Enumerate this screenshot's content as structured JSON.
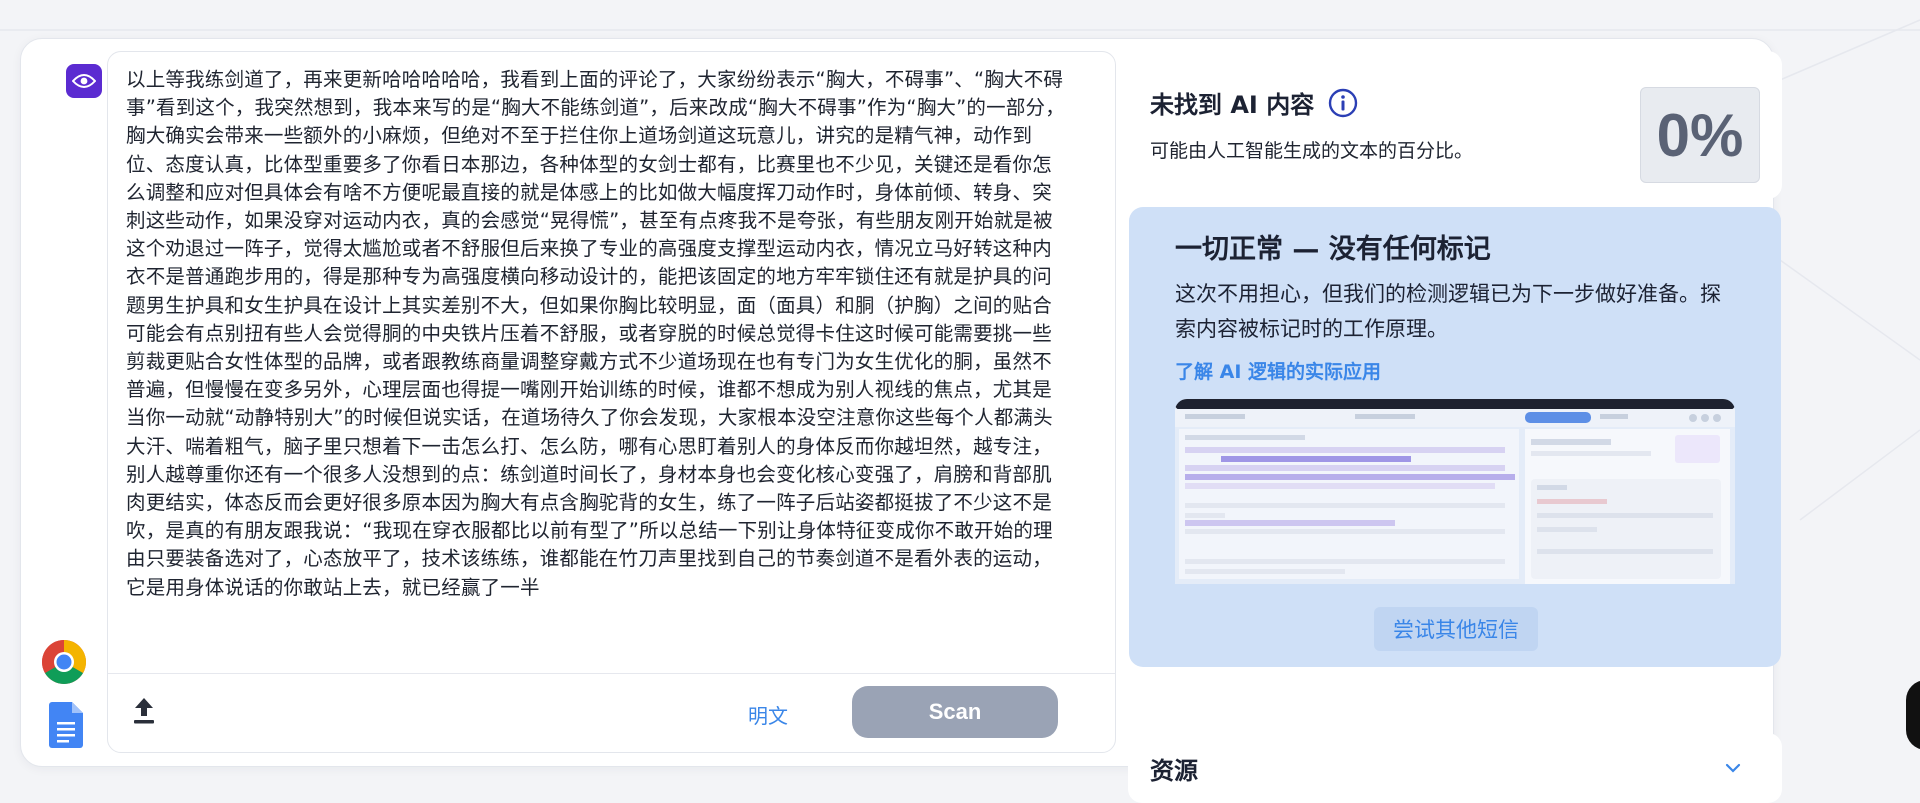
{
  "editor": {
    "text": "以上等我练剑道了，再来更新哈哈哈哈哈，我看到上面的评论了，大家纷纷表示“胸大，不碍事”、“胸大不碍事”看到这个，我突然想到，我本来写的是“胸大不能练剑道”，后来改成“胸大不碍事”作为“胸大”的一部分，胸大确实会带来一些额外的小麻烦，但绝对不至于拦住你上道场剑道这玩意儿，讲究的是精气神，动作到位、态度认真，比体型重要多了你看日本那边，各种体型的女剑士都有，比赛里也不少见，关键还是看你怎么调整和应对但具体会有啥不方便呢最直接的就是体感上的比如做大幅度挥刀动作时，身体前倾、转身、突刺这些动作，如果没穿对运动内衣，真的会感觉“晃得慌”，甚至有点疼我不是夸张，有些朋友刚开始就是被这个劝退过一阵子，觉得太尴尬或者不舒服但后来换了专业的高强度支撑型运动内衣，情况立马好转这种内衣不是普通跑步用的，得是那种专为高强度横向移动设计的，能把该固定的地方牢牢锁住还有就是护具的问题男生护具和女生护具在设计上其实差别不大，但如果你胸比较明显，面（面具）和胴（护胸）之间的贴合可能会有点别扭有些人会觉得胴的中央铁片压着不舒服，或者穿脱的时候总觉得卡住这时候可能需要挑一些剪裁更贴合女性体型的品牌，或者跟教练商量调整穿戴方式不少道场现在也有专门为女生优化的胴，虽然不普遍，但慢慢在变多另外，心理层面也得提一嘴刚开始训练的时候，谁都不想成为别人视线的焦点，尤其是当你一动就“动静特别大”的时候但说实话，在道场待久了你会发现，大家根本没空注意你这些每个人都满头大汗、喘着粗气，脑子里只想着下一击怎么打、怎么防，哪有心思盯着别人的身体反而你越坦然，越专注，别人越尊重你还有一个很多人没想到的点：练剑道时间长了，身材本身也会变化核心变强了，肩膀和背部肌肉更结实，体态反而会更好很多原本因为胸大有点含胸驼背的女生，练了一阵子后站姿都挺拔了不少这不是吹，是真的有朋友跟我说：“我现在穿衣服都比以前有型了”所以总结一下别让身体特征变成你不敢开始的理由只要装备选对了，心态放平了，技术该练练，谁都能在竹刀声里找到自己的节奏剑道不是看外表的运动，它是用身体说话的你敢站上去，就已经赢了一半",
    "plain_label": "明文",
    "scan_label": "Scan"
  },
  "result": {
    "title": "未找到 AI 内容",
    "subtitle": "可能由人工智能生成的文本的百分比。",
    "percent": "0%"
  },
  "status_card": {
    "title": "一切正常 — 没有任何标记",
    "description": "这次不用担心，但我们的检测逻辑已为下一步做好准备。探索内容被标记时的工作原理。",
    "link": "了解 AI 逻辑的实际应用",
    "try_button": "尝试其他短信"
  },
  "resources": {
    "title": "资源"
  },
  "icons": {
    "rail": [
      "eye-icon",
      "chrome-icon",
      "google-docs-icon"
    ],
    "upload": "upload-icon",
    "info": "info-icon",
    "chevron": "chevron-down-icon"
  },
  "colors": {
    "accent_purple": "#5b2bd1",
    "link_blue": "#3a86e8",
    "scan_button": "#9aa3b5",
    "status_card_bg": "#cfe0f7"
  }
}
